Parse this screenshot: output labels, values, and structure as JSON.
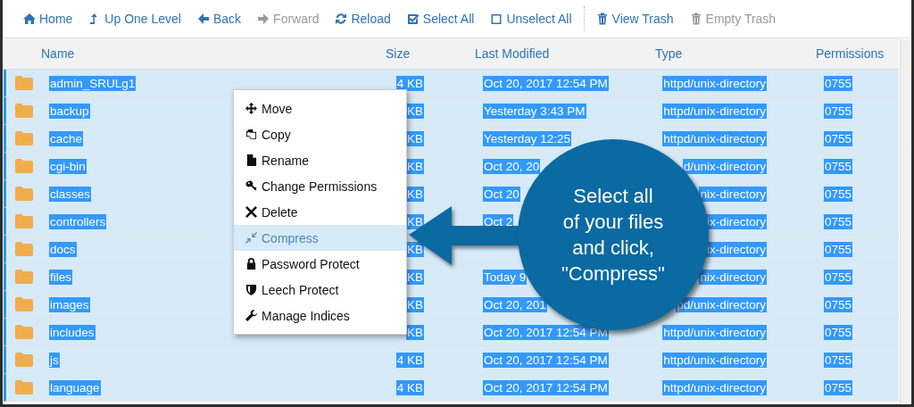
{
  "toolbar": [
    {
      "label": "Home",
      "disabled": false
    },
    {
      "label": "Up One Level",
      "disabled": false
    },
    {
      "label": "Back",
      "disabled": false
    },
    {
      "label": "Forward",
      "disabled": true
    },
    {
      "label": "Reload",
      "disabled": false
    },
    {
      "label": "Select All",
      "disabled": false
    },
    {
      "label": "Unselect All",
      "disabled": false
    },
    {
      "label": "View Trash",
      "disabled": false
    },
    {
      "label": "Empty Trash",
      "disabled": true
    }
  ],
  "table": {
    "columns": [
      "Name",
      "Size",
      "Last Modified",
      "Type",
      "Permissions"
    ],
    "rows": [
      {
        "selected": true,
        "name": "admin_SRULg1",
        "size": "4 KB",
        "modified": "Oct 20, 2017 12:54 PM",
        "type": "httpd/unix-directory",
        "permissions": "0755"
      },
      {
        "selected": true,
        "name": "backup",
        "size": "KB",
        "modified": "Yesterday 3:43 PM",
        "type": "httpd/unix-directory",
        "permissions": "0755"
      },
      {
        "selected": true,
        "name": "cache",
        "size": "KB",
        "modified": "Yesterday 12:25",
        "type": "httpd/unix-directory",
        "permissions": "0755"
      },
      {
        "selected": true,
        "name": "cgi-bin",
        "size": "KB",
        "modified": "Oct 20, 20",
        "type": "d/unix-directory",
        "permissions": "0755"
      },
      {
        "selected": true,
        "name": "classes",
        "size": "KB",
        "modified": "Oct 20",
        "type": "nix-directory",
        "permissions": "0755"
      },
      {
        "selected": true,
        "name": "controllers",
        "size": "KB",
        "modified": "Oct 2",
        "type": "ix-directory",
        "permissions": "0755"
      },
      {
        "selected": true,
        "name": "docs",
        "size": "KB",
        "type": "ix-directory",
        "permissions": "0755"
      },
      {
        "selected": true,
        "name": "files",
        "size": "KB",
        "modified": "Today 9",
        "type": "nix-directory",
        "permissions": "0755"
      },
      {
        "selected": true,
        "name": "images",
        "size": "KB",
        "modified": "Oct 20, 201",
        "type": "pd/unix-directory",
        "permissions": "0755"
      },
      {
        "selected": true,
        "name": "includes",
        "size": "KB",
        "modified": "Oct 20, 2017 12:54 PM",
        "type": "httpd/unix-directory",
        "permissions": "0755"
      },
      {
        "selected": true,
        "name": "js",
        "size": "4 KB",
        "modified": "Oct 20, 2017 12:54 PM",
        "type": "httpd/unix-directory",
        "permissions": "0755"
      },
      {
        "selected": true,
        "name": "language",
        "size": "4 KB",
        "modified": "Oct 20, 2017 12:54 PM",
        "type": "httpd/unix-directory",
        "permissions": "0755"
      }
    ]
  },
  "context_menu": [
    {
      "label": "Move",
      "selected": false
    },
    {
      "label": "Copy",
      "selected": false
    },
    {
      "label": "Rename",
      "selected": false
    },
    {
      "label": "Change Permissions",
      "selected": false
    },
    {
      "label": "Delete",
      "selected": false
    },
    {
      "label": "Compress",
      "selected": true
    },
    {
      "label": "Password Protect",
      "selected": false
    },
    {
      "label": "Leech Protect",
      "selected": false
    },
    {
      "label": "Manage Indices",
      "selected": false
    }
  ],
  "callout": {
    "text": "Select all\nof your files\nand click,\n\"Compress\""
  }
}
